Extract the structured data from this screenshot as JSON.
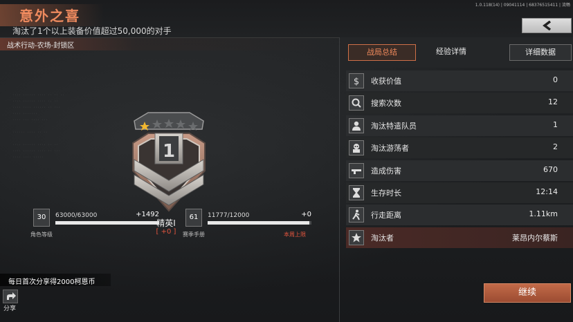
{
  "header": {
    "title": "意外之喜",
    "subtitle": "淘汰了1个以上装备价值超过50,000的对手",
    "build_info": "1.0.118(14) | 09041114 | 68376515411 | 流畅"
  },
  "location": "战术行动-农场-封锁区",
  "rank": {
    "tier_number": "1",
    "name": "精英I",
    "delta": "+0"
  },
  "character_level": {
    "level": "30",
    "progress_text": "63000/63000",
    "progress_fraction": 1.0,
    "gain": "+1492",
    "caption": "角色等级"
  },
  "season_pass": {
    "level": "61",
    "progress_text": "11777/12000",
    "progress_fraction": 0.981,
    "gain": "+0",
    "caption": "赛季手册",
    "weekly_cap": "本周上限"
  },
  "share": {
    "tip": "每日首次分享得2000柯恩币",
    "label": "分享"
  },
  "tabs": [
    {
      "label": "战局总结"
    },
    {
      "label": "经验详情"
    },
    {
      "label": "详细数据"
    }
  ],
  "stats": [
    {
      "label": "收获价值",
      "value": "0",
      "icon": "dollar-icon"
    },
    {
      "label": "搜索次数",
      "value": "12",
      "icon": "search-icon"
    },
    {
      "label": "淘汰特遣队员",
      "value": "1",
      "icon": "operator-icon"
    },
    {
      "label": "淘汰游荡者",
      "value": "2",
      "icon": "raider-icon"
    },
    {
      "label": "造成伤害",
      "value": "670",
      "icon": "gun-icon"
    },
    {
      "label": "生存时长",
      "value": "12:14",
      "icon": "hourglass-icon"
    },
    {
      "label": "行走距离",
      "value": "1.11km",
      "icon": "walker-icon"
    },
    {
      "label": "淘汰者",
      "value": "莱昂内尔蔡斯",
      "icon": "skull-star-icon"
    }
  ],
  "continue_label": "继续",
  "colors": {
    "accent": "#ee8a5e",
    "danger": "#e2553e"
  }
}
